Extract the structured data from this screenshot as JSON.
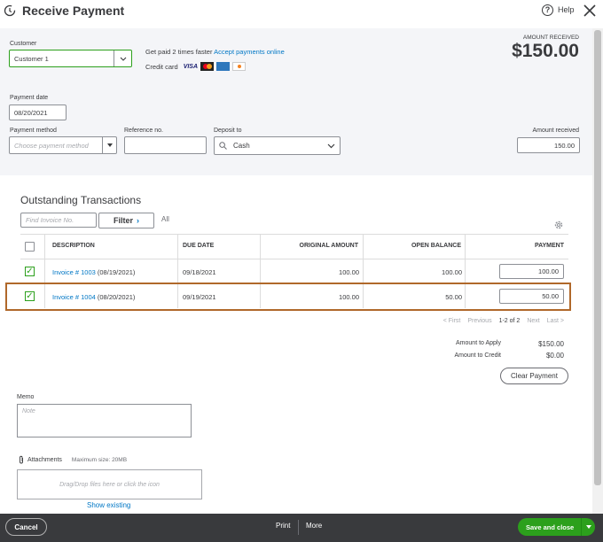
{
  "header": {
    "title": "Receive Payment",
    "help_label": "Help"
  },
  "customer": {
    "label": "Customer",
    "value": "Customer 1"
  },
  "promo": {
    "get_paid_text": "Get paid 2 times faster",
    "accept_link": "Accept payments online",
    "credit_card_label": "Credit card",
    "card_brands": [
      "VISA",
      "MC",
      "AMEX",
      "DISCOVER"
    ]
  },
  "amount_received_header": {
    "label": "AMOUNT RECEIVED",
    "value": "$150.00"
  },
  "payment_date": {
    "label": "Payment date",
    "value": "08/20/2021"
  },
  "payment_method": {
    "label": "Payment method",
    "placeholder": "Choose payment method"
  },
  "reference": {
    "label": "Reference no.",
    "value": ""
  },
  "deposit_to": {
    "label": "Deposit to",
    "value": "Cash"
  },
  "amount_received_field": {
    "label": "Amount received",
    "value": "150.00"
  },
  "outstanding": {
    "title": "Outstanding Transactions",
    "find_placeholder": "Find Invoice No.",
    "filter_label": "Filter",
    "all_label": "All",
    "columns": [
      "DESCRIPTION",
      "DUE DATE",
      "ORIGINAL AMOUNT",
      "OPEN BALANCE",
      "PAYMENT"
    ],
    "rows": [
      {
        "link": "Invoice # 1003",
        "date_suffix": "(08/19/2021)",
        "due_date": "09/18/2021",
        "original": "100.00",
        "open": "100.00",
        "payment": "100.00",
        "checked": true
      },
      {
        "link": "Invoice # 1004",
        "date_suffix": "(08/20/2021)",
        "due_date": "09/19/2021",
        "original": "100.00",
        "open": "50.00",
        "payment": "50.00",
        "checked": true
      }
    ]
  },
  "pagination": {
    "first": "< First",
    "previous": "Previous",
    "range": "1-2 of 2",
    "next": "Next",
    "last": "Last >"
  },
  "totals": {
    "apply_label": "Amount to Apply",
    "apply_value": "$150.00",
    "credit_label": "Amount to Credit",
    "credit_value": "$0.00",
    "clear_label": "Clear Payment"
  },
  "memo": {
    "label": "Memo",
    "placeholder": "Note"
  },
  "attachments": {
    "label": "Attachments",
    "max_size": "Maximum size: 20MB",
    "drop_text": "Drag/Drop files here or click the icon",
    "show_existing": "Show existing"
  },
  "footer": {
    "cancel": "Cancel",
    "print": "Print",
    "more": "More",
    "save_close": "Save and close"
  },
  "colors": {
    "accent_green": "#2ca01c",
    "link_blue": "#0077c5",
    "highlight_border": "#b0682a",
    "footer_bg": "#393a3d"
  }
}
